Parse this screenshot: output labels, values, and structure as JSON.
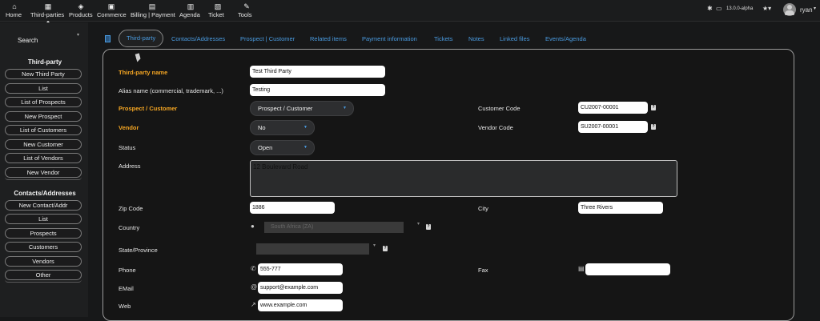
{
  "topmenu": {
    "items": [
      {
        "label": "Home",
        "icon": "home-icon"
      },
      {
        "label": "Third-parties",
        "icon": "building-icon"
      },
      {
        "label": "Products",
        "icon": "cube-icon"
      },
      {
        "label": "Commerce",
        "icon": "briefcase-icon"
      },
      {
        "label": "Billing | Payment",
        "icon": "money-icon"
      },
      {
        "label": "Agenda",
        "icon": "calendar-icon"
      },
      {
        "label": "Ticket",
        "icon": "ticket-icon"
      },
      {
        "label": "Tools",
        "icon": "wrench-icon"
      }
    ],
    "version": "13.0.0-alpha",
    "user": "ryan"
  },
  "sidebar": {
    "search_label": "Search",
    "group1_title": "Third-party",
    "group1_items": [
      "New Third Party",
      "List",
      "List of Prospects",
      "New Prospect",
      "List of Customers",
      "New Customer",
      "List of Vendors",
      "New Vendor"
    ],
    "group2_title": "Contacts/Addresses",
    "group2_items": [
      "New Contact/Addr",
      "List",
      "Prospects",
      "Customers",
      "Vendors",
      "Other"
    ]
  },
  "tabs": [
    "Third-party",
    "Contacts/Addresses",
    "Prospect | Customer",
    "Related items",
    "Payment information",
    "Tickets",
    "Notes",
    "Linked files",
    "Events/Agenda"
  ],
  "form": {
    "name_label": "Third-party name",
    "name_value": "Test Third Party",
    "alias_label": "Alias name (commercial, trademark, ...)",
    "alias_value": "Testing",
    "prospect_label": "Prospect / Customer",
    "prospect_value": "Prospect / Customer",
    "customer_code_label": "Customer Code",
    "customer_code_value": "CU2007-00001",
    "vendor_label": "Vendor",
    "vendor_value": "No",
    "vendor_code_label": "Vendor Code",
    "vendor_code_value": "SU2007-00001",
    "status_label": "Status",
    "status_value": "Open",
    "address_label": "Address",
    "address_value": "12 Boulevard Road",
    "zip_label": "Zip Code",
    "zip_value": "1886",
    "city_label": "City",
    "city_value": "Three Rivers",
    "country_label": "Country",
    "country_value": "South Africa (ZA)",
    "state_label": "State/Province",
    "phone_label": "Phone",
    "phone_value": "555-777",
    "fax_label": "Fax",
    "fax_value": "",
    "email_label": "EMail",
    "email_value": "support@example.com",
    "web_label": "Web",
    "web_value": "www.example.com"
  },
  "colors": {
    "accent": "#4a9be0",
    "required": "#f5a623"
  }
}
